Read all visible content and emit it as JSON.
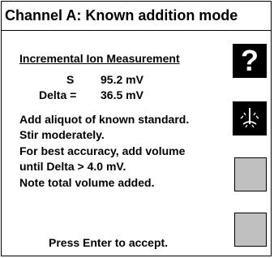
{
  "screen": {
    "title": "Channel A: Known addition mode",
    "heading": "Incremental Ion Measurement",
    "readings": [
      {
        "label": "S",
        "value": "95.2 mV"
      },
      {
        "label": "Delta =",
        "value": "36.5 mV"
      }
    ],
    "instructions": [
      "Add aliquot of known standard.",
      "Stir moderately.",
      "For best accuracy, add volume",
      "until Delta > 4.0 mV.",
      "Note total volume added."
    ],
    "footer": "Press Enter to accept."
  },
  "buttons": {
    "help_label": "?",
    "help_icon": "question-mark-icon",
    "stir_icon": "stir-icon"
  }
}
